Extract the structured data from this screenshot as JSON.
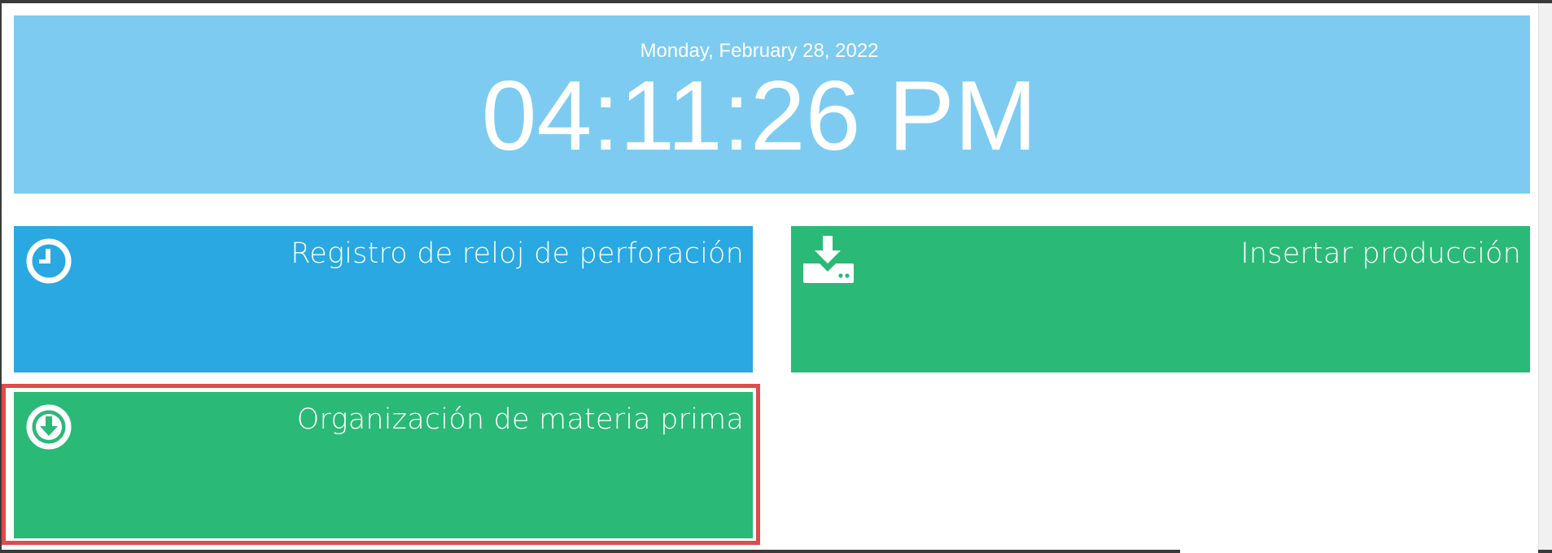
{
  "clock": {
    "date": "Monday, February 28, 2022",
    "time": "04:11:26 PM"
  },
  "tiles": [
    {
      "title": "Registro de reloj de perforación",
      "icon": "clock-icon",
      "color": "#29a8e1"
    },
    {
      "title": "Insertar producción",
      "icon": "download-drive-icon",
      "color": "#2bb978"
    },
    {
      "title": "Organización de materia prima",
      "icon": "arrow-down-circle-icon",
      "color": "#2bb978",
      "highlighted": true
    }
  ],
  "colors": {
    "clock_panel": "#7dcbf1",
    "highlight": "#e04a49"
  }
}
